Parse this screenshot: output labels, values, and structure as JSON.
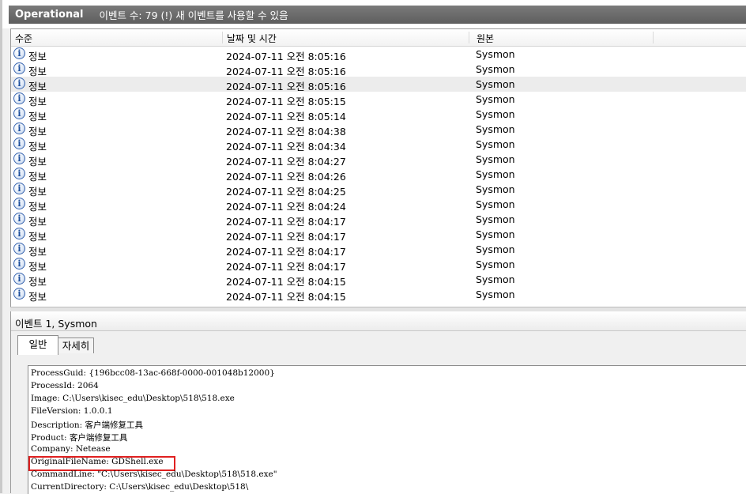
{
  "header": {
    "title": "Operational",
    "count_text": "이벤트 수: 79 (!) 새 이벤트를 사용할 수 있음"
  },
  "columns": {
    "level": "수준",
    "datetime": "날짜 및 시간",
    "source": "원본"
  },
  "events": [
    {
      "level": "정보",
      "datetime": "2024-07-11 오전 8:05:16",
      "source": "Sysmon",
      "icon": "info-icon"
    },
    {
      "level": "정보",
      "datetime": "2024-07-11 오전 8:05:16",
      "source": "Sysmon",
      "icon": "info-icon"
    },
    {
      "level": "정보",
      "datetime": "2024-07-11 오전 8:05:16",
      "source": "Sysmon",
      "icon": "info-icon",
      "selected": true
    },
    {
      "level": "정보",
      "datetime": "2024-07-11 오전 8:05:15",
      "source": "Sysmon",
      "icon": "info-icon"
    },
    {
      "level": "정보",
      "datetime": "2024-07-11 오전 8:05:14",
      "source": "Sysmon",
      "icon": "info-icon"
    },
    {
      "level": "정보",
      "datetime": "2024-07-11 오전 8:04:38",
      "source": "Sysmon",
      "icon": "info-icon"
    },
    {
      "level": "정보",
      "datetime": "2024-07-11 오전 8:04:34",
      "source": "Sysmon",
      "icon": "info-icon"
    },
    {
      "level": "정보",
      "datetime": "2024-07-11 오전 8:04:27",
      "source": "Sysmon",
      "icon": "info-icon"
    },
    {
      "level": "정보",
      "datetime": "2024-07-11 오전 8:04:26",
      "source": "Sysmon",
      "icon": "info-icon"
    },
    {
      "level": "정보",
      "datetime": "2024-07-11 오전 8:04:25",
      "source": "Sysmon",
      "icon": "info-icon"
    },
    {
      "level": "정보",
      "datetime": "2024-07-11 오전 8:04:24",
      "source": "Sysmon",
      "icon": "info-icon"
    },
    {
      "level": "정보",
      "datetime": "2024-07-11 오전 8:04:17",
      "source": "Sysmon",
      "icon": "info-icon"
    },
    {
      "level": "정보",
      "datetime": "2024-07-11 오전 8:04:17",
      "source": "Sysmon",
      "icon": "info-icon"
    },
    {
      "level": "정보",
      "datetime": "2024-07-11 오전 8:04:17",
      "source": "Sysmon",
      "icon": "info-icon"
    },
    {
      "level": "정보",
      "datetime": "2024-07-11 오전 8:04:17",
      "source": "Sysmon",
      "icon": "info-icon"
    },
    {
      "level": "정보",
      "datetime": "2024-07-11 오전 8:04:15",
      "source": "Sysmon",
      "icon": "info-icon"
    },
    {
      "level": "정보",
      "datetime": "2024-07-11 오전 8:04:15",
      "source": "Sysmon",
      "icon": "info-icon"
    }
  ],
  "detail": {
    "title": "이벤트 1, Sysmon",
    "tabs": [
      "일반",
      "자세히"
    ],
    "lines": [
      "ProcessGuid: {196bcc08-13ac-668f-0000-001048b12000}",
      "ProcessId: 2064",
      "Image: C:\\Users\\kisec_edu\\Desktop\\518\\518.exe",
      "FileVersion: 1.0.0.1",
      "Description: 客户端修复工具",
      "Product: 客户端修复工具",
      "Company: Netease",
      "OriginalFileName: GDShell.exe",
      "CommandLine: \"C:\\Users\\kisec_edu\\Desktop\\518\\518.exe\"",
      "CurrentDirectory: C:\\Users\\kisec_edu\\Desktop\\518\\"
    ],
    "highlight_color": "#e02020"
  }
}
